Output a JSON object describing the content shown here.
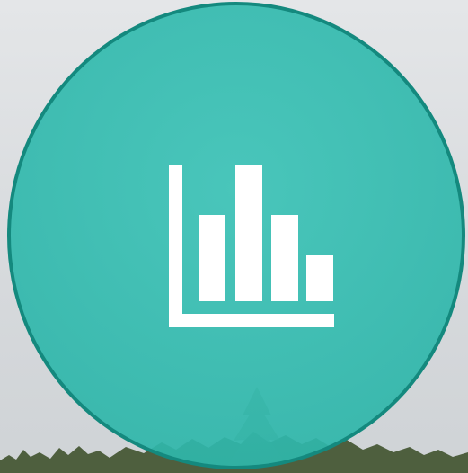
{
  "app_icon": {
    "icon": "bar-chart-icon",
    "circle_color": "#2fb5aa",
    "border_color": "#14897e",
    "glyph_color": "#ffffff"
  },
  "background": {
    "sky_color": "#d8dbde",
    "tree_color": "#4e5f3e"
  }
}
